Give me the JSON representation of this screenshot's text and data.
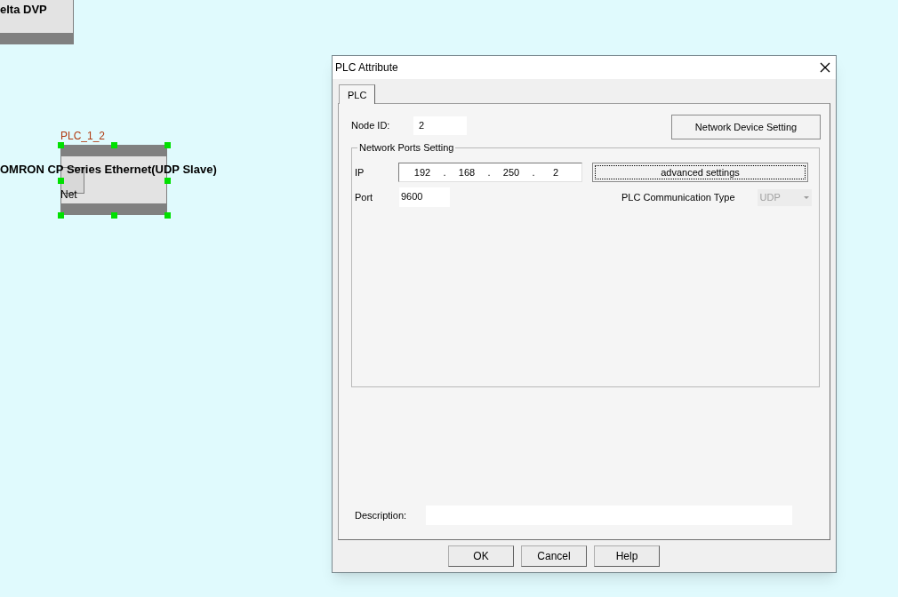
{
  "canvas": {
    "nodes": [
      {
        "kind": "device",
        "title": "elta DVP",
        "selected": false
      },
      {
        "kind": "device",
        "label": "PLC_1_2",
        "title": "OMRON CP Series Ethernet(UDP Slave)",
        "port_label": "Net",
        "selected": true
      }
    ]
  },
  "dialog": {
    "title": "PLC Attribute",
    "tabs": [
      {
        "label": "PLC",
        "selected": true
      }
    ],
    "node_id": {
      "label": "Node ID:",
      "value": "2"
    },
    "network_device_button": "Network Device Setting",
    "ports_group": {
      "legend": "Network Ports Setting",
      "ip": {
        "label": "IP",
        "octets": [
          "192",
          "168",
          "250",
          "2"
        ],
        "separator": "."
      },
      "advanced_button": {
        "label": "advanced settings",
        "focused": true
      },
      "port": {
        "label": "Port",
        "value": "9600"
      },
      "comm_type": {
        "label": "PLC Communication Type",
        "value": "UDP",
        "disabled": true
      }
    },
    "description": {
      "label": "Description:"
    },
    "buttons": [
      "OK",
      "Cancel",
      "Help"
    ]
  }
}
